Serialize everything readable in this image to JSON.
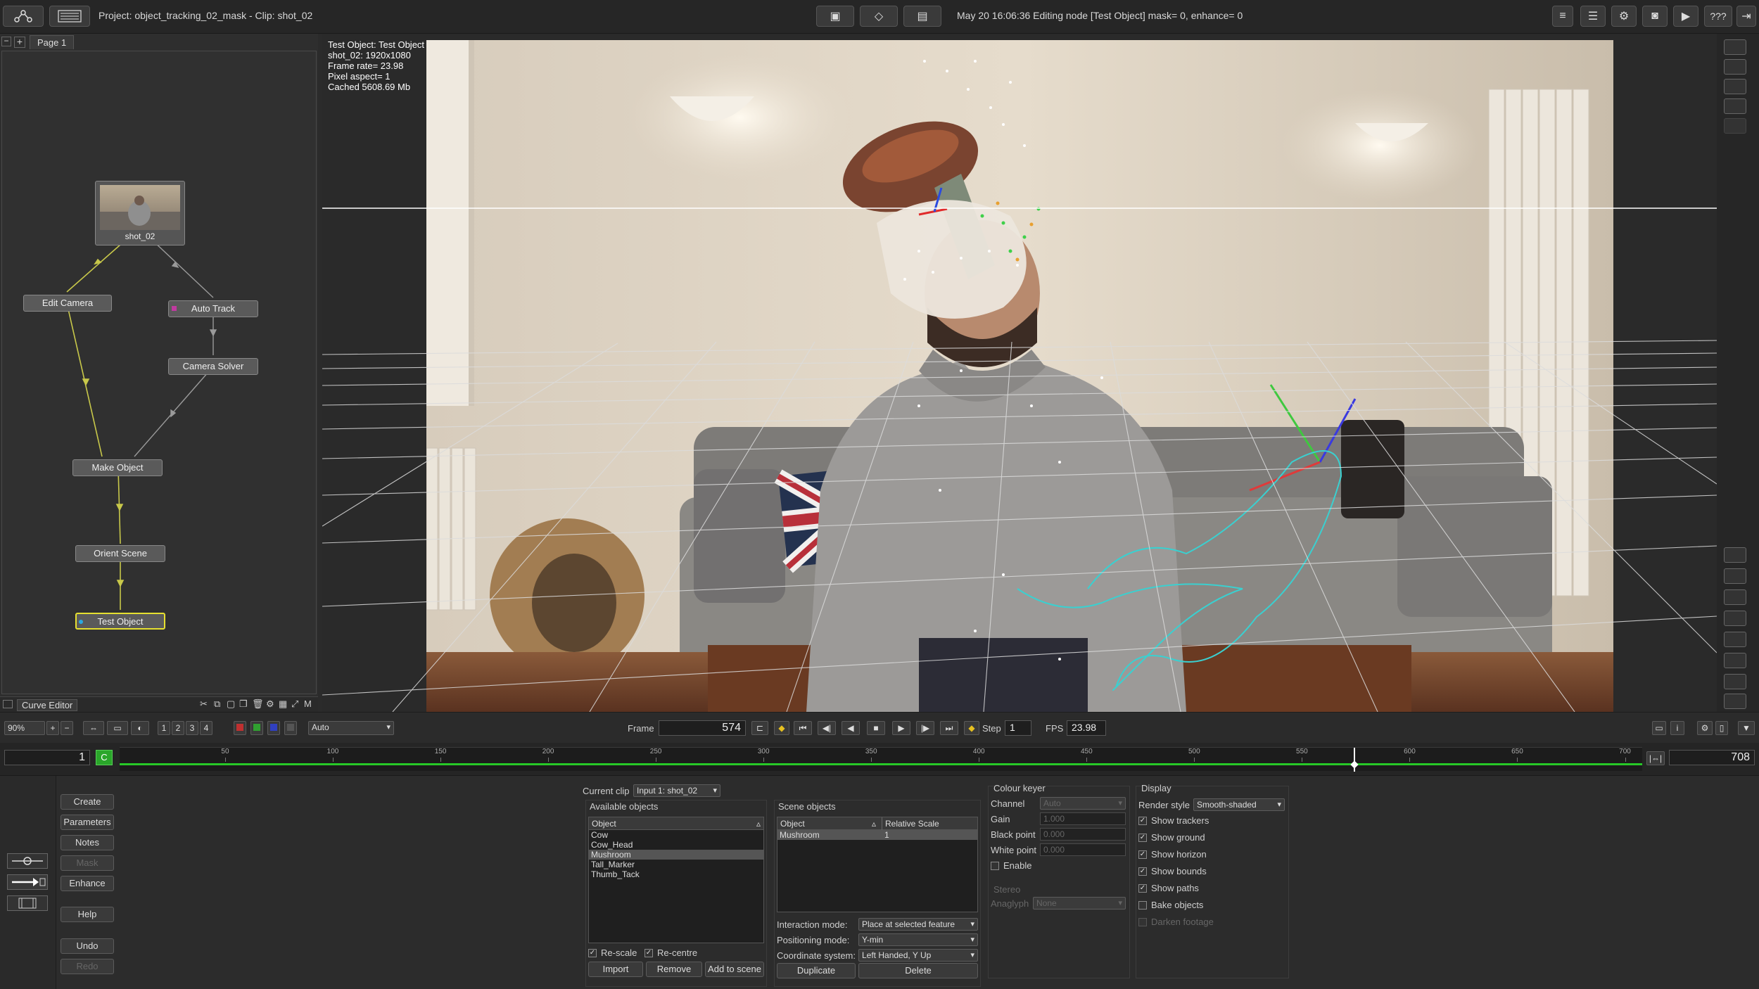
{
  "topbar": {
    "project_label": "Project: object_tracking_02_mask - Clip: shot_02",
    "status": "May 20 16:06:36 Editing node [Test Object] mask= 0, enhance= 0",
    "help_label": "???"
  },
  "nodegraph": {
    "page_tab": "Page 1",
    "nodes": {
      "shot": "shot_02",
      "edit_camera": "Edit Camera",
      "auto_track": "Auto Track",
      "camera_solver": "Camera Solver",
      "make_object": "Make Object",
      "orient_scene": "Orient Scene",
      "test_object": "Test Object"
    },
    "curve_editor_label": "Curve Editor"
  },
  "viewer": {
    "info": {
      "line1": "Test Object: Test Object",
      "line2": "shot_02: 1920x1080",
      "line3": "Frame rate= 23.98",
      "line4": "Pixel aspect= 1",
      "line5": "Cached 5608.69 Mb"
    }
  },
  "transport": {
    "zoom": "90%",
    "view_buttons": [
      "1",
      "2",
      "3",
      "4"
    ],
    "auto_select": "Auto",
    "frame_label": "Frame",
    "frame_value": "574",
    "step_label": "Step",
    "step_value": "1",
    "fps_label": "FPS",
    "fps_value": "23.98"
  },
  "timeline": {
    "start": "1",
    "end": "708",
    "c_marker": "C",
    "ticks": [
      "50",
      "100",
      "150",
      "200",
      "250",
      "300",
      "350",
      "400",
      "450",
      "500",
      "550",
      "600",
      "650",
      "700"
    ],
    "current_frame": 574,
    "range_min": 1,
    "range_max": 708
  },
  "sidebar": {
    "create": "Create",
    "parameters": "Parameters",
    "notes": "Notes",
    "mask": "Mask",
    "enhance": "Enhance",
    "help": "Help",
    "undo": "Undo",
    "redo": "Redo"
  },
  "params": {
    "current_clip_label": "Current clip",
    "current_clip_value": "Input 1: shot_02",
    "available_objects_label": "Available objects",
    "available_header": "Object",
    "available_items": [
      "Cow",
      "Cow_Head",
      "Mushroom",
      "Tall_Marker",
      "Thumb_Tack"
    ],
    "selected_item": "Mushroom",
    "rescale_label": "Re-scale",
    "recentre_label": "Re-centre",
    "import_label": "Import",
    "remove_label": "Remove",
    "add_to_scene_label": "Add to scene",
    "scene_objects_label": "Scene objects",
    "scene_header_object": "Object",
    "scene_header_scale": "Relative Scale",
    "scene_row_object": "Mushroom",
    "scene_row_scale": "1",
    "interaction_mode_label": "Interaction mode:",
    "interaction_mode_value": "Place at selected feature",
    "positioning_mode_label": "Positioning mode:",
    "positioning_mode_value": "Y-min",
    "coordinate_system_label": "Coordinate system:",
    "coordinate_system_value": "Left Handed, Y Up",
    "duplicate_label": "Duplicate",
    "delete_label": "Delete"
  },
  "colour_keyer": {
    "title": "Colour keyer",
    "channel_label": "Channel",
    "channel_value": "Auto",
    "gain_label": "Gain",
    "gain_value": "1.000",
    "black_point_label": "Black point",
    "black_point_value": "0.000",
    "white_point_label": "White point",
    "white_point_value": "0.000",
    "enable_label": "Enable",
    "stereo_title": "Stereo",
    "anaglyph_label": "Anaglyph",
    "anaglyph_value": "None"
  },
  "display": {
    "title": "Display",
    "render_style_label": "Render style",
    "render_style_value": "Smooth-shaded",
    "show_trackers": "Show trackers",
    "show_ground": "Show ground",
    "show_horizon": "Show horizon",
    "show_bounds": "Show bounds",
    "show_paths": "Show paths",
    "bake_objects": "Bake objects",
    "darken_footage": "Darken footage"
  }
}
